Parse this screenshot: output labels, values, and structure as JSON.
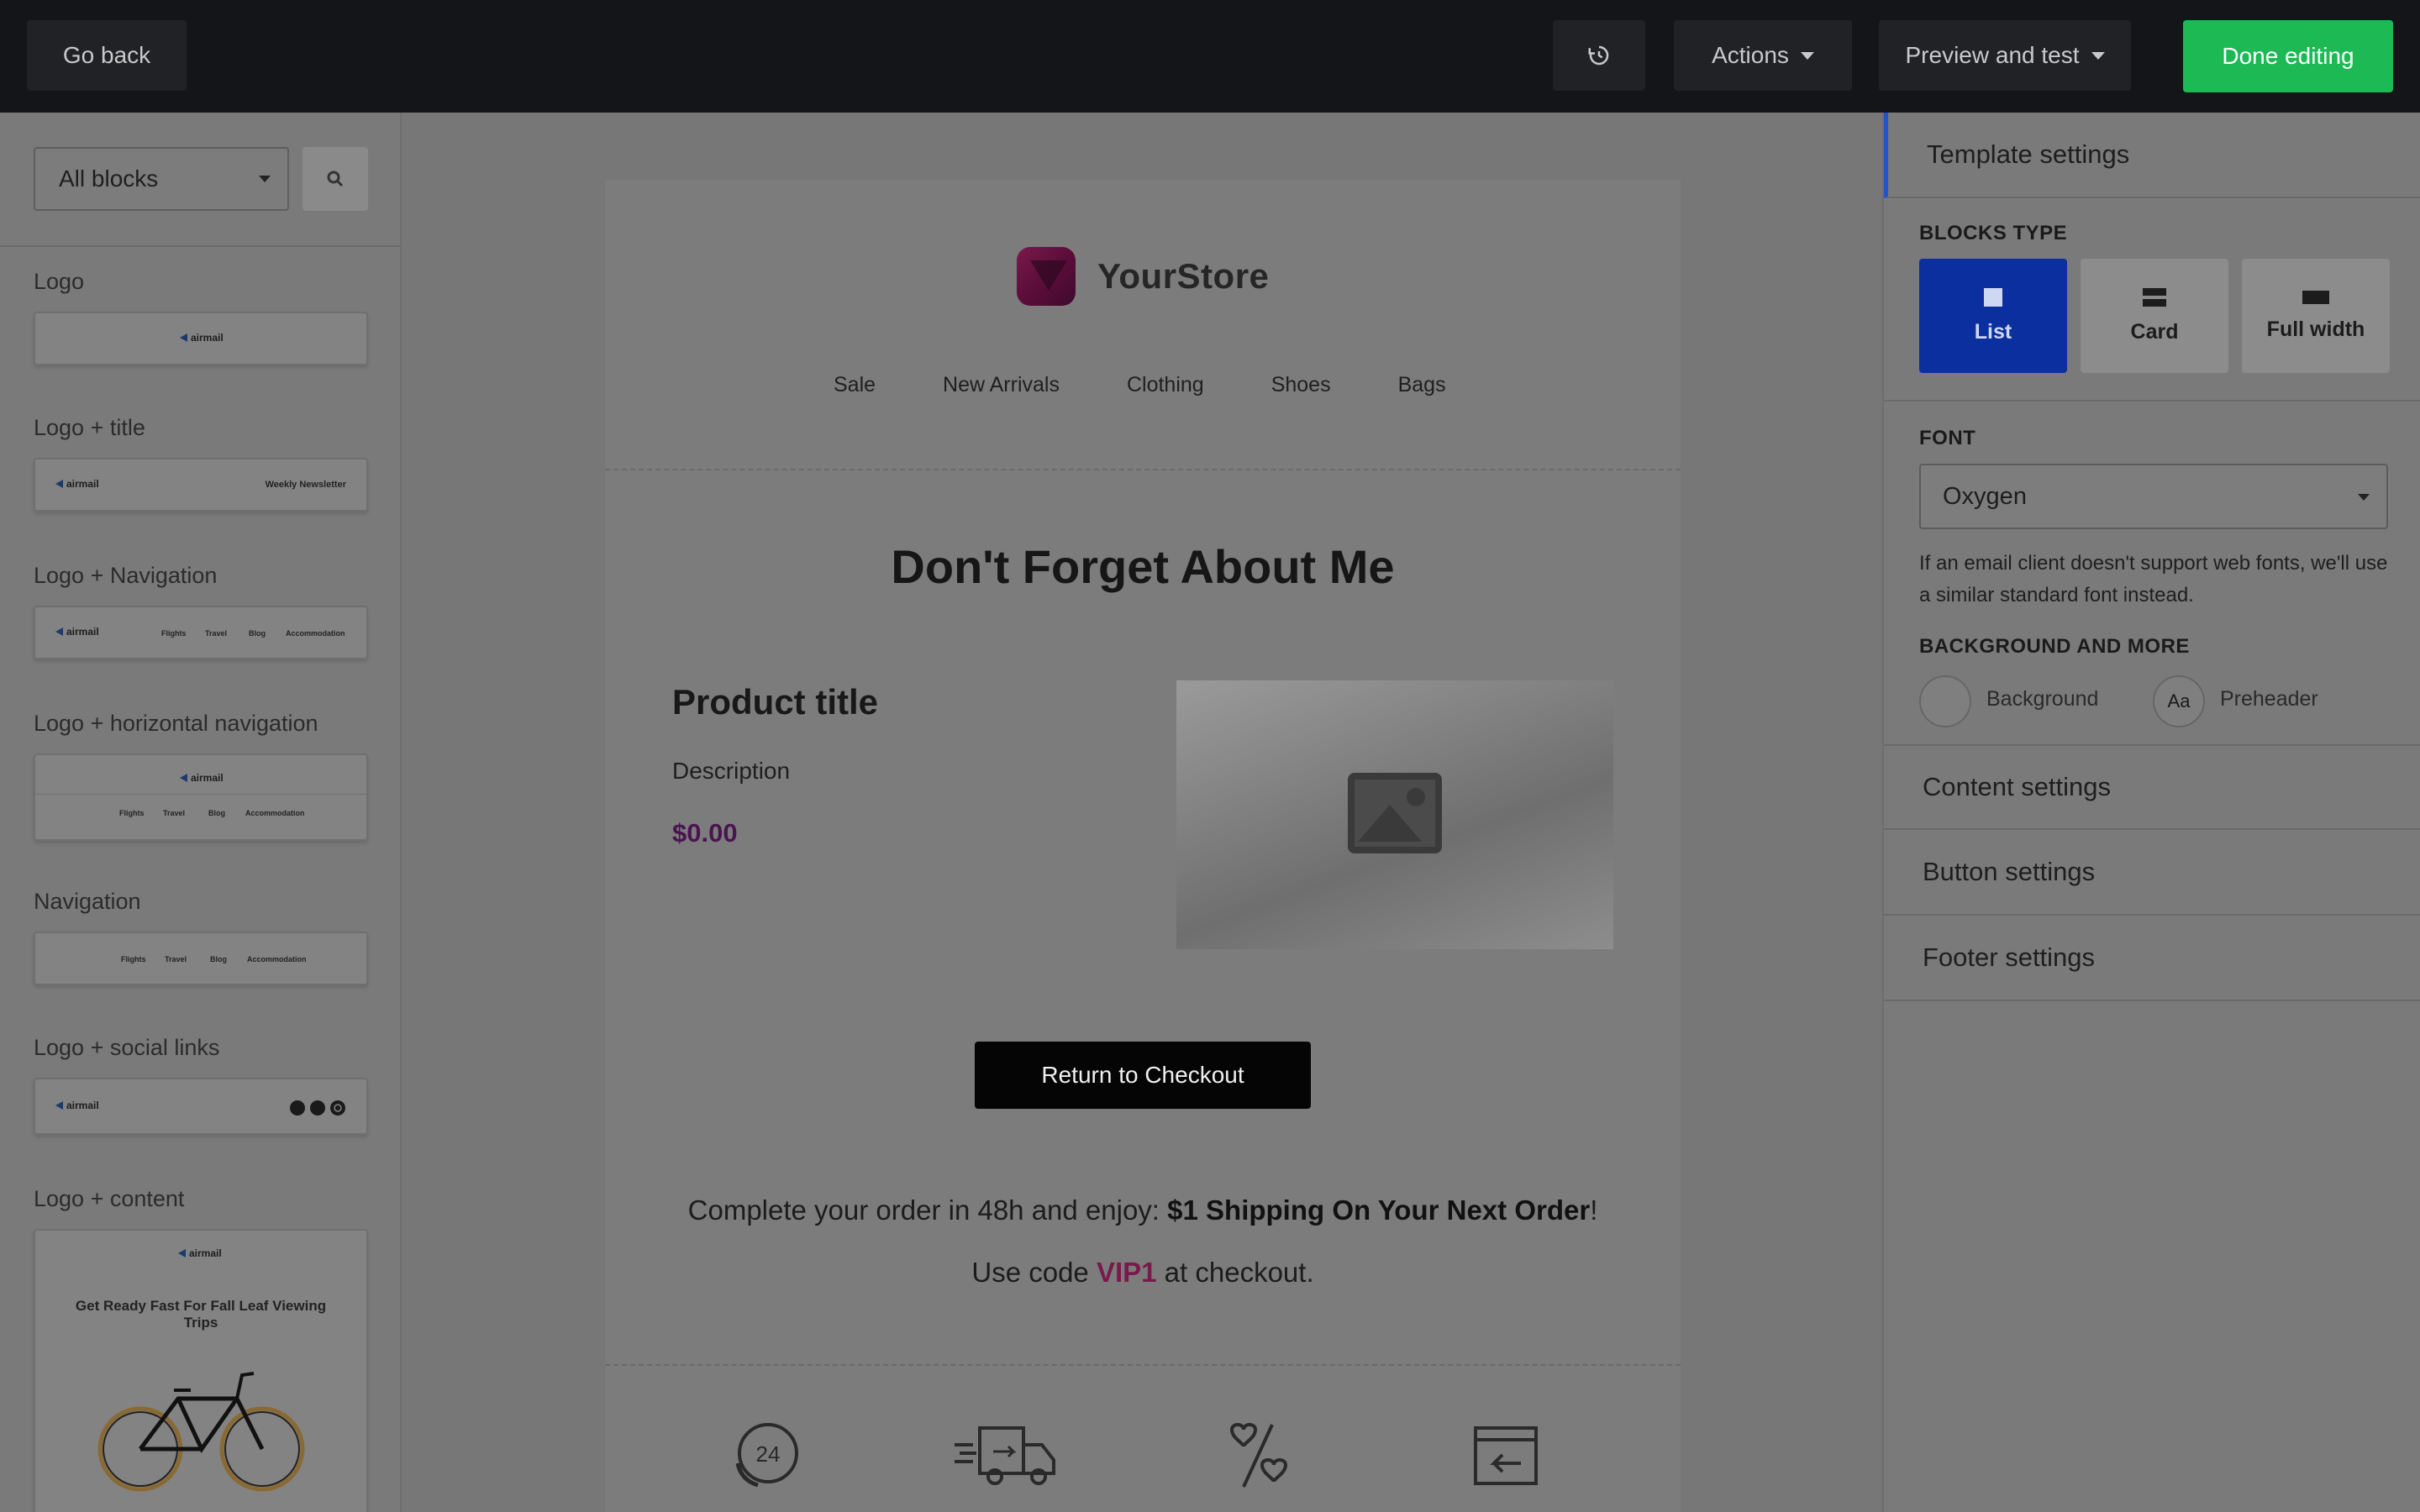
{
  "topbar": {
    "back_label": "Go back",
    "actions_label": "Actions",
    "preview_label": "Preview and test",
    "done_label": "Done editing"
  },
  "sidebar": {
    "filter_value": "All blocks",
    "groups": [
      {
        "label": "Logo"
      },
      {
        "label": "Logo + title",
        "mini_title": "Weekly Newsletter"
      },
      {
        "label": "Logo + Navigation"
      },
      {
        "label": "Logo + horizontal navigation"
      },
      {
        "label": "Navigation"
      },
      {
        "label": "Logo + social links"
      },
      {
        "label": "Logo + content",
        "mini_heading": "Get Ready Fast For Fall Leaf Viewing Trips"
      }
    ],
    "mini_brand": "airmail",
    "mini_nav": [
      "Flights",
      "Travel",
      "Blog",
      "Accommodation"
    ]
  },
  "email": {
    "store_name": "YourStore",
    "nav": [
      "Sale",
      "New Arrivals",
      "Clothing",
      "Shoes",
      "Bags"
    ],
    "headline": "Don't Forget About Me",
    "product_title": "Product title",
    "product_description": "Description",
    "product_price": "$0.00",
    "cta_label": "Return to Checkout",
    "promo_line1_prefix": "Complete your order in 48h and enjoy: ",
    "promo_line1_bold": "$1 Shipping On Your Next Order",
    "promo_line1_suffix": "!",
    "promo_line2_prefix": "Use code ",
    "promo_code": "VIP1",
    "promo_line2_suffix": " at checkout."
  },
  "rpanel": {
    "template_settings": "Template settings",
    "blocks_type_label": "BLOCKS TYPE",
    "types": [
      "List",
      "Card",
      "Full width"
    ],
    "font_label": "FONT",
    "font_value": "Oxygen",
    "font_note": "If an email client doesn't support web fonts, we'll use a similar standard font instead.",
    "bg_label": "BACKGROUND AND MORE",
    "background_label": "Background",
    "preheader_label": "Preheader",
    "preheader_glyph": "Aa",
    "content_settings": "Content settings",
    "button_settings": "Button settings",
    "footer_settings": "Footer settings"
  },
  "colors": {
    "done_button": "#1db954",
    "selected_type": "#0b2f9e",
    "promo_code": "#7a1a4c",
    "price": "#4a1450"
  },
  "icons": [
    "history-icon",
    "search-icon",
    "image-placeholder-icon",
    "support-24h-icon",
    "fast-delivery-icon",
    "discount-heart-icon",
    "return-box-icon"
  ]
}
